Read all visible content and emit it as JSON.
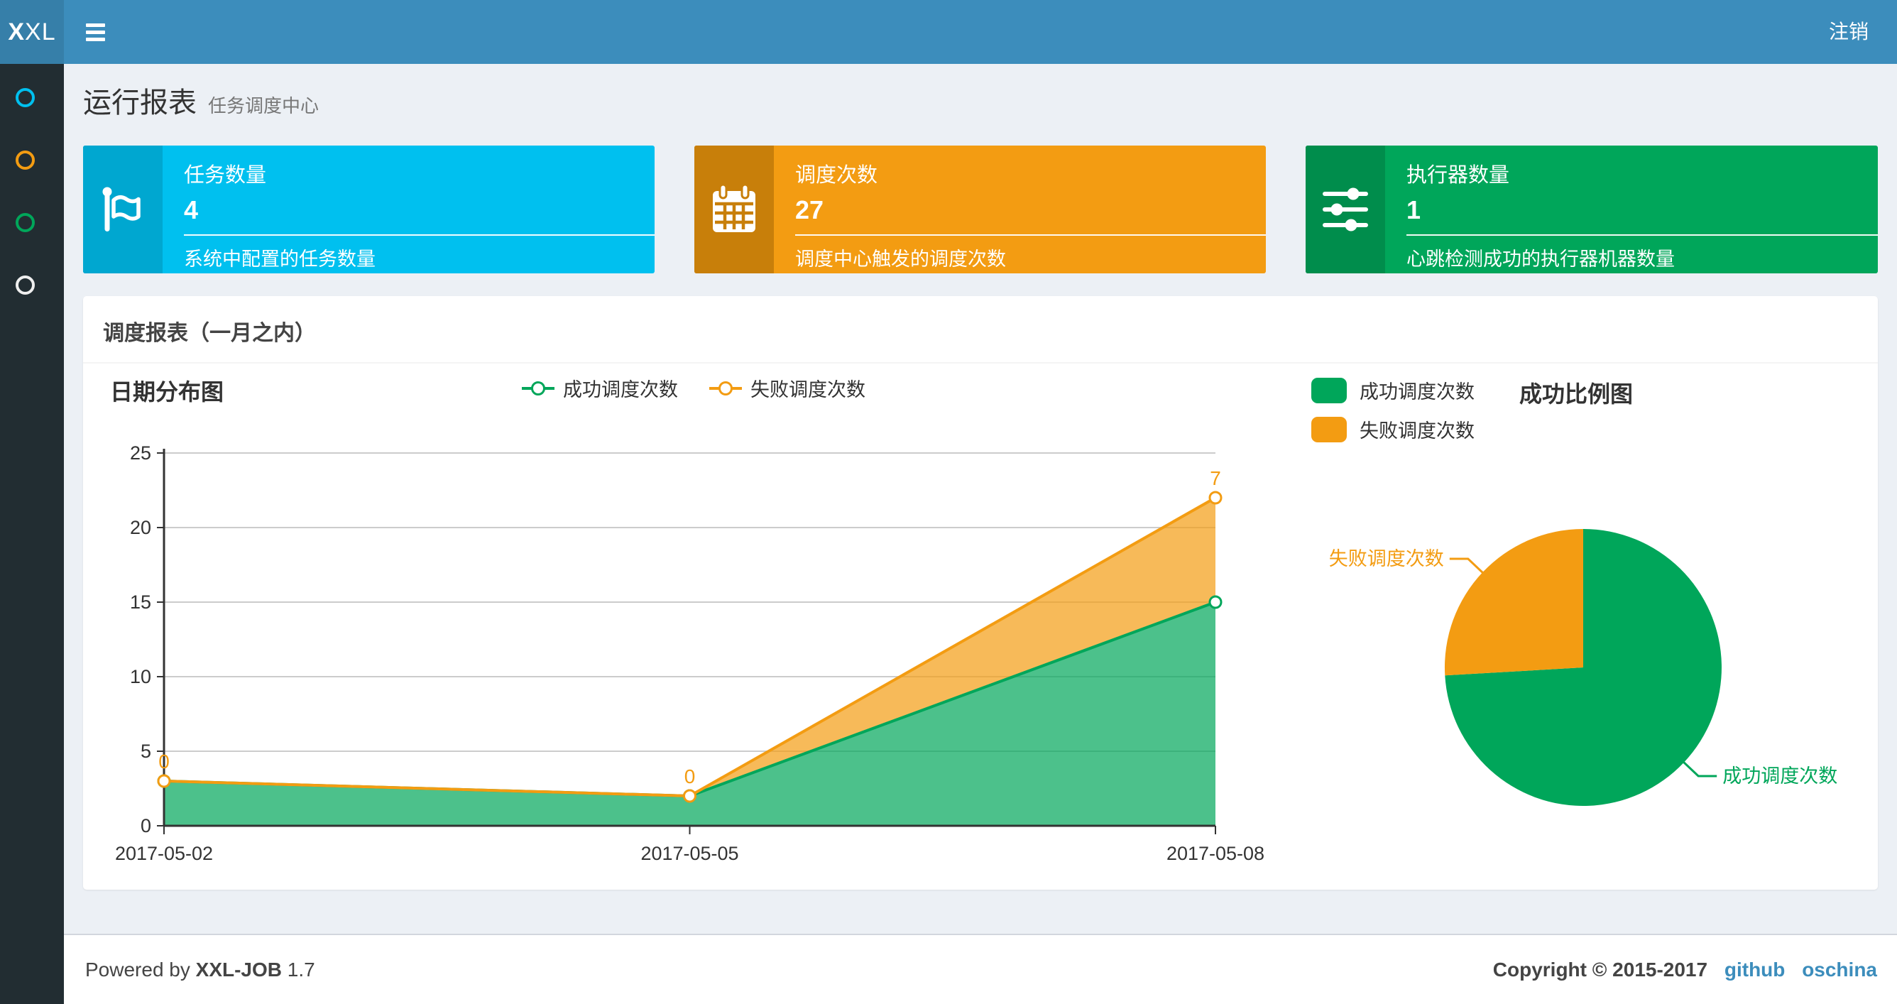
{
  "navbar": {
    "logo": {
      "bold": "X",
      "rest": "XL"
    },
    "logout_label": "注销"
  },
  "sidebar": {
    "items": [
      {
        "name": "menu-item-1",
        "color": "#00c0ef"
      },
      {
        "name": "menu-item-2",
        "color": "#f39c12"
      },
      {
        "name": "menu-item-3",
        "color": "#00a65a"
      },
      {
        "name": "menu-item-4",
        "color": "#eeeeee"
      }
    ]
  },
  "page_header": {
    "title": "运行报表",
    "subtitle": "任务调度中心"
  },
  "stat_cards": [
    {
      "icon": "flag-icon",
      "label": "任务数量",
      "value": "4",
      "description": "系统中配置的任务数量",
      "bg": "#00c0ef",
      "icon_bg": "#00a7d0"
    },
    {
      "icon": "calendar-icon",
      "label": "调度次数",
      "value": "27",
      "description": "调度中心触发的调度次数",
      "bg": "#f39c12",
      "icon_bg": "#c87f0a"
    },
    {
      "icon": "sliders-icon",
      "label": "执行器数量",
      "value": "1",
      "description": "心跳检测成功的执行器机器数量",
      "bg": "#00a65a",
      "icon_bg": "#008d4c"
    }
  ],
  "panel": {
    "title": "调度报表（一月之内）"
  },
  "chart_data": [
    {
      "type": "area",
      "title": "日期分布图",
      "stacked": true,
      "categories": [
        "2017-05-02",
        "2017-05-05",
        "2017-05-08"
      ],
      "series": [
        {
          "name": "成功调度次数",
          "values": [
            3,
            2,
            15
          ],
          "color": "#00a65a"
        },
        {
          "name": "失败调度次数",
          "values": [
            0,
            0,
            7
          ],
          "color": "#f39c12"
        }
      ],
      "point_labels": {
        "series": "失败调度次数",
        "values": [
          "0",
          "0",
          "7"
        ]
      },
      "xlabel": "",
      "ylabel": "",
      "ylim": [
        0,
        25
      ],
      "yticks": [
        0,
        5,
        10,
        15,
        20,
        25
      ],
      "grid": true,
      "legend_position": "top-center"
    },
    {
      "type": "pie",
      "title": "成功比例图",
      "slices": [
        {
          "label": "成功调度次数",
          "value": 20,
          "color": "#00a65a"
        },
        {
          "label": "失败调度次数",
          "value": 7,
          "color": "#f39c12"
        }
      ],
      "start_angle": 90,
      "direction": "clockwise",
      "legend_position": "top-left"
    }
  ],
  "footer": {
    "powered_prefix": "Powered by",
    "product": "XXL-JOB",
    "version": "1.7",
    "copyright": "Copyright © 2015-2017",
    "links": [
      {
        "label": "github"
      },
      {
        "label": "oschina"
      }
    ]
  }
}
